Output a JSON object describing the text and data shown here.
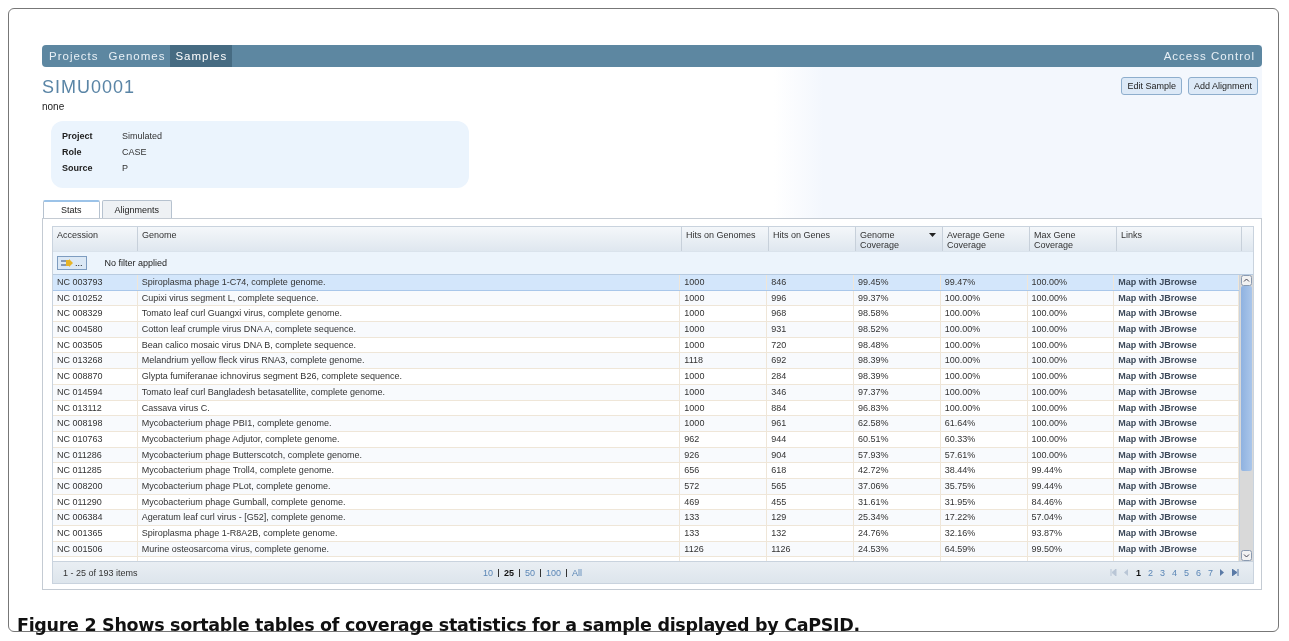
{
  "nav": {
    "tabs": [
      {
        "label": "Projects",
        "selected": false
      },
      {
        "label": "Genomes",
        "selected": false
      },
      {
        "label": "Samples",
        "selected": true
      }
    ],
    "right_link": "Access Control"
  },
  "sample": {
    "title": "SIMU0001",
    "description": "none",
    "buttons": [
      "Edit Sample",
      "Add Alignment"
    ],
    "fields": [
      {
        "label": "Project",
        "value": "Simulated"
      },
      {
        "label": "Role",
        "value": "CASE"
      },
      {
        "label": "Source",
        "value": "P"
      }
    ]
  },
  "tabs": [
    {
      "label": "Stats",
      "selected": true
    },
    {
      "label": "Alignments",
      "selected": false
    }
  ],
  "table": {
    "columns": [
      {
        "label": "Accession",
        "sorted": false
      },
      {
        "label": "Genome",
        "sorted": false
      },
      {
        "label": "Hits on Genomes",
        "sorted": false
      },
      {
        "label": "Hits on Genes",
        "sorted": false
      },
      {
        "label": "Genome Coverage",
        "sorted": true
      },
      {
        "label": "Average Gene Coverage",
        "sorted": false
      },
      {
        "label": "Max Gene Coverage",
        "sorted": false
      },
      {
        "label": "Links",
        "sorted": false
      }
    ],
    "filter_button": "...",
    "filter_text": "No filter applied",
    "rows": [
      {
        "selected": true,
        "cells": [
          "NC 003793",
          "Spiroplasma phage 1-C74, complete genome.",
          "1000",
          "846",
          "99.45%",
          "99.47%",
          "100.00%",
          "Map with JBrowse"
        ]
      },
      {
        "selected": false,
        "cells": [
          "NC 010252",
          "Cupixi virus segment L, complete sequence.",
          "1000",
          "996",
          "99.37%",
          "100.00%",
          "100.00%",
          "Map with JBrowse"
        ]
      },
      {
        "selected": false,
        "cells": [
          "NC 008329",
          "Tomato leaf curl Guangxi virus, complete genome.",
          "1000",
          "968",
          "98.58%",
          "100.00%",
          "100.00%",
          "Map with JBrowse"
        ]
      },
      {
        "selected": false,
        "cells": [
          "NC 004580",
          "Cotton leaf crumple virus DNA A, complete sequence.",
          "1000",
          "931",
          "98.52%",
          "100.00%",
          "100.00%",
          "Map with JBrowse"
        ]
      },
      {
        "selected": false,
        "cells": [
          "NC 003505",
          "Bean calico mosaic virus DNA B, complete sequence.",
          "1000",
          "720",
          "98.48%",
          "100.00%",
          "100.00%",
          "Map with JBrowse"
        ]
      },
      {
        "selected": false,
        "cells": [
          "NC 013268",
          "Melandrium yellow fleck virus RNA3, complete genome.",
          "1118",
          "692",
          "98.39%",
          "100.00%",
          "100.00%",
          "Map with JBrowse"
        ]
      },
      {
        "selected": false,
        "cells": [
          "NC 008870",
          "Glypta fumiferanae ichnovirus segment B26, complete sequence.",
          "1000",
          "284",
          "98.39%",
          "100.00%",
          "100.00%",
          "Map with JBrowse"
        ]
      },
      {
        "selected": false,
        "cells": [
          "NC 014594",
          "Tomato leaf curl Bangladesh betasatellite, complete genome.",
          "1000",
          "346",
          "97.37%",
          "100.00%",
          "100.00%",
          "Map with JBrowse"
        ]
      },
      {
        "selected": false,
        "cells": [
          "NC 013112",
          "Cassava virus C.",
          "1000",
          "884",
          "96.83%",
          "100.00%",
          "100.00%",
          "Map with JBrowse"
        ]
      },
      {
        "selected": false,
        "cells": [
          "NC 008198",
          "Mycobacterium phage PBI1, complete genome.",
          "1000",
          "961",
          "62.58%",
          "61.64%",
          "100.00%",
          "Map with JBrowse"
        ]
      },
      {
        "selected": false,
        "cells": [
          "NC 010763",
          "Mycobacterium phage Adjutor, complete genome.",
          "962",
          "944",
          "60.51%",
          "60.33%",
          "100.00%",
          "Map with JBrowse"
        ]
      },
      {
        "selected": false,
        "cells": [
          "NC 011286",
          "Mycobacterium phage Butterscotch, complete genome.",
          "926",
          "904",
          "57.93%",
          "57.61%",
          "100.00%",
          "Map with JBrowse"
        ]
      },
      {
        "selected": false,
        "cells": [
          "NC 011285",
          "Mycobacterium phage Troll4, complete genome.",
          "656",
          "618",
          "42.72%",
          "38.44%",
          "99.44%",
          "Map with JBrowse"
        ]
      },
      {
        "selected": false,
        "cells": [
          "NC 008200",
          "Mycobacterium phage PLot, complete genome.",
          "572",
          "565",
          "37.06%",
          "35.75%",
          "99.44%",
          "Map with JBrowse"
        ]
      },
      {
        "selected": false,
        "cells": [
          "NC 011290",
          "Mycobacterium phage Gumball, complete genome.",
          "469",
          "455",
          "31.61%",
          "31.95%",
          "84.46%",
          "Map with JBrowse"
        ]
      },
      {
        "selected": false,
        "cells": [
          "NC 006384",
          "Ageratum leaf curl virus - [G52], complete genome.",
          "133",
          "129",
          "25.34%",
          "17.22%",
          "57.04%",
          "Map with JBrowse"
        ]
      },
      {
        "selected": false,
        "cells": [
          "NC 001365",
          "Spiroplasma phage 1-R8A2B, complete genome.",
          "133",
          "132",
          "24.76%",
          "32.16%",
          "93.87%",
          "Map with JBrowse"
        ]
      },
      {
        "selected": false,
        "cells": [
          "NC 001506",
          "Murine osteosarcoma virus, complete genome.",
          "1126",
          "1126",
          "24.53%",
          "64.59%",
          "99.50%",
          "Map with JBrowse"
        ]
      }
    ]
  },
  "pager": {
    "summary": "1 - 25 of 193 items",
    "sizes": [
      {
        "label": "10",
        "selected": false
      },
      {
        "label": "25",
        "selected": true
      },
      {
        "label": "50",
        "selected": false
      },
      {
        "label": "100",
        "selected": false
      },
      {
        "label": "All",
        "selected": false
      }
    ],
    "pages": [
      {
        "label": "1",
        "selected": true
      },
      {
        "label": "2",
        "selected": false
      },
      {
        "label": "3",
        "selected": false
      },
      {
        "label": "4",
        "selected": false
      },
      {
        "label": "5",
        "selected": false
      },
      {
        "label": "6",
        "selected": false
      },
      {
        "label": "7",
        "selected": false
      }
    ]
  },
  "caption": {
    "label": "Figure 2",
    "text": "Shows sortable tables of coverage statistics for a sample displayed by CaPSID."
  }
}
